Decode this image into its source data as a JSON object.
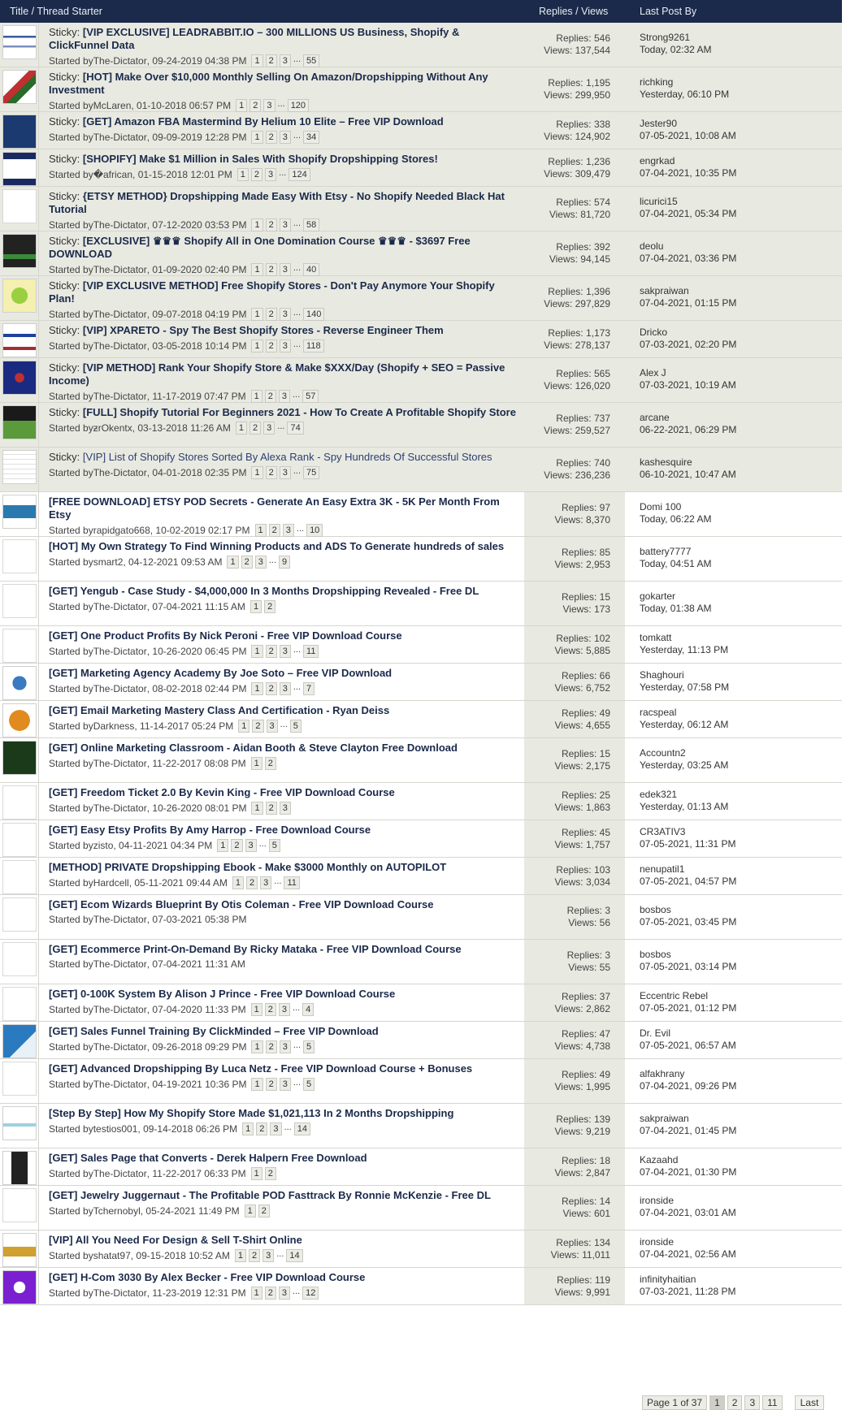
{
  "header": {
    "col1": "Title / Thread Starter",
    "col2": "Replies / Views",
    "col3": "Last Post By"
  },
  "sticky_label": "Sticky:",
  "started_by": "Started by",
  "threads": [
    {
      "sticky": true,
      "thumb": "shop",
      "title": "[VIP EXCLUSIVE] LEADRABBIT.IO – 300 MILLIONS US Business, Shopify & ClickFunnel Data",
      "starter": "The-Dictator",
      "date": "09-24-2019 04:38 PM",
      "pages": [
        "1",
        "2",
        "3",
        "55"
      ],
      "replies": "Replies: 546",
      "views": "Views: 137,544",
      "last_user": "Strong9261",
      "last_time": "Today, 02:32 AM"
    },
    {
      "sticky": true,
      "thumb": "money",
      "title": "[HOT] Make Over $10,000 Monthly Selling On Amazon/Dropshipping Without Any Investment",
      "starter": "McLaren",
      "date": "01-10-2018 06:57 PM",
      "pages": [
        "1",
        "2",
        "3",
        "120"
      ],
      "replies": "Replies: 1,195",
      "views": "Views: 299,950",
      "last_user": "richking",
      "last_time": "Yesterday, 06:10 PM"
    },
    {
      "sticky": true,
      "thumb": "helium",
      "title": "[GET] Amazon FBA Mastermind By Helium 10 Elite – Free VIP Download",
      "starter": "The-Dictator",
      "date": "09-09-2019 12:28 PM",
      "pages": [
        "1",
        "2",
        "3",
        "34"
      ],
      "replies": "Replies: 338",
      "views": "Views: 124,902",
      "last_user": "Jester90",
      "last_time": "07-05-2021, 10:08 AM"
    },
    {
      "sticky": true,
      "thumb": "screen",
      "title": "[SHOPIFY] Make $1 Million in Sales With Shopify Dropshipping Stores!",
      "starter": "�african",
      "date": "01-15-2018 12:01 PM",
      "pages": [
        "1",
        "2",
        "3",
        "124"
      ],
      "replies": "Replies: 1,236",
      "views": "Views: 309,479",
      "last_user": "engrkad",
      "last_time": "07-04-2021, 10:35 PM"
    },
    {
      "sticky": true,
      "thumb": "blank",
      "title": "{ETSY METHOD} Dropshipping Made Easy With Etsy - No Shopify Needed Black Hat Tutorial",
      "starter": "The-Dictator",
      "date": "07-12-2020 03:53 PM",
      "pages": [
        "1",
        "2",
        "3",
        "58"
      ],
      "replies": "Replies: 574",
      "views": "Views: 81,720",
      "last_user": "licurici15",
      "last_time": "07-04-2021, 05:34 PM"
    },
    {
      "sticky": true,
      "thumb": "dark",
      "title": "[EXCLUSIVE] ♛♛♛ Shopify All in One Domination Course ♛♛♛ - $3697 Free DOWNLOAD",
      "starter": "The-Dictator",
      "date": "01-09-2020 02:40 PM",
      "pages": [
        "1",
        "2",
        "3",
        "40"
      ],
      "replies": "Replies: 392",
      "views": "Views: 94,145",
      "last_user": "deolu",
      "last_time": "07-04-2021, 03:36 PM"
    },
    {
      "sticky": true,
      "thumb": "green",
      "title": "[VIP EXCLUSIVE METHOD] Free Shopify Stores - Don't Pay Anymore Your Shopify Plan!",
      "starter": "The-Dictator",
      "date": "09-07-2018 04:19 PM",
      "pages": [
        "1",
        "2",
        "3",
        "140"
      ],
      "replies": "Replies: 1,396",
      "views": "Views: 297,829",
      "last_user": "sakpraiwan",
      "last_time": "07-04-2021, 01:15 PM"
    },
    {
      "sticky": true,
      "thumb": "xpareto",
      "title": "[VIP] XPARETO - Spy The Best Shopify Stores - Reverse Engineer Them",
      "starter": "The-Dictator",
      "date": "03-05-2018 10:14 PM",
      "pages": [
        "1",
        "2",
        "3",
        "118"
      ],
      "replies": "Replies: 1,173",
      "views": "Views: 278,137",
      "last_user": "Dricko",
      "last_time": "07-03-2021, 02:20 PM"
    },
    {
      "sticky": true,
      "thumb": "seo",
      "title": "[VIP METHOD] Rank Your Shopify Store & Make $XXX/Day (Shopify + SEO = Passive Income)",
      "starter": "The-Dictator",
      "date": "11-17-2019 07:47 PM",
      "pages": [
        "1",
        "2",
        "3",
        "57"
      ],
      "replies": "Replies: 565",
      "views": "Views: 126,020",
      "last_user": "Alex J",
      "last_time": "07-03-2021, 10:19 AM"
    },
    {
      "sticky": true,
      "thumb": "shopify",
      "title": "[FULL] Shopify Tutorial For Beginners 2021 - How To Create A Profitable Shopify Store",
      "starter": "ƶrOkentx",
      "date": "03-13-2018 11:26 AM",
      "pages": [
        "1",
        "2",
        "3",
        "74"
      ],
      "replies": "Replies: 737",
      "views": "Views: 259,527",
      "last_user": "arcane",
      "last_time": "06-22-2021, 06:29 PM"
    },
    {
      "sticky": true,
      "plain": true,
      "thumb": "grid",
      "title": "[VIP] List of Shopify Stores Sorted By Alexa Rank - Spy Hundreds Of Successful Stores",
      "starter": "The-Dictator",
      "date": "04-01-2018 02:35 PM",
      "pages": [
        "1",
        "2",
        "3",
        "75"
      ],
      "replies": "Replies: 740",
      "views": "Views: 236,236",
      "last_user": "kashesquire",
      "last_time": "06-10-2021, 10:47 AM"
    },
    {
      "sticky": false,
      "thumb": "etsy",
      "title": "[FREE DOWNLOAD] ETSY POD Secrets - Generate An Easy Extra 3K - 5K Per Month From Etsy",
      "starter": "rapidgato668",
      "date": "10-02-2019 02:17 PM",
      "pages": [
        "1",
        "2",
        "3",
        "10"
      ],
      "replies": "Replies: 97",
      "views": "Views: 8,370",
      "last_user": "Domi 100",
      "last_time": "Today, 06:22 AM"
    },
    {
      "sticky": false,
      "thumb": "blank",
      "title": "[HOT] My Own Strategy To Find Winning Products and ADS To Generate hundreds of sales",
      "starter": "smart2",
      "date": "04-12-2021 09:53 AM",
      "pages": [
        "1",
        "2",
        "3",
        "9"
      ],
      "replies": "Replies: 85",
      "views": "Views: 2,953",
      "last_user": "battery7777",
      "last_time": "Today, 04:51 AM"
    },
    {
      "sticky": false,
      "thumb": "blank",
      "title": "[GET] Yengub - Case Study - $4,000,000 In 3 Months Dropshipping Revealed - Free DL",
      "starter": "The-Dictator",
      "date": "07-04-2021 11:15 AM",
      "pages": [
        "1",
        "2"
      ],
      "replies": "Replies: 15",
      "views": "Views: 173",
      "last_user": "gokarter",
      "last_time": "Today, 01:38 AM"
    },
    {
      "sticky": false,
      "thumb": "blank",
      "title": "[GET] One Product Profits By Nick Peroni - Free VIP Download Course",
      "starter": "The-Dictator",
      "date": "10-26-2020 06:45 PM",
      "pages": [
        "1",
        "2",
        "3",
        "11"
      ],
      "replies": "Replies: 102",
      "views": "Views: 5,885",
      "last_user": "tomkatt",
      "last_time": "Yesterday, 11:13 PM"
    },
    {
      "sticky": false,
      "thumb": "agency",
      "title": "[GET] Marketing Agency Academy By Joe Soto – Free VIP Download",
      "starter": "The-Dictator",
      "date": "08-02-2018 02:44 PM",
      "pages": [
        "1",
        "2",
        "3",
        "7"
      ],
      "replies": "Replies: 66",
      "views": "Views: 6,752",
      "last_user": "Shaghouri",
      "last_time": "Yesterday, 07:58 PM"
    },
    {
      "sticky": false,
      "thumb": "badge",
      "title": "[GET] Email Marketing Mastery Class And Certification - Ryan Deiss",
      "starter": "Darkness",
      "date": "11-14-2017 05:24 PM",
      "pages": [
        "1",
        "2",
        "3",
        "5"
      ],
      "replies": "Replies: 49",
      "views": "Views: 4,655",
      "last_user": "racspeal",
      "last_time": "Yesterday, 06:12 AM"
    },
    {
      "sticky": false,
      "thumb": "marketing",
      "title": "[GET] Online Marketing Classroom - Aidan Booth & Steve Clayton Free Download",
      "starter": "The-Dictator",
      "date": "11-22-2017 08:08 PM",
      "pages": [
        "1",
        "2"
      ],
      "replies": "Replies: 15",
      "views": "Views: 2,175",
      "last_user": "Accountn2",
      "last_time": "Yesterday, 03:25 AM"
    },
    {
      "sticky": false,
      "thumb": "blank",
      "title": "[GET] Freedom Ticket 2.0 By Kevin King - Free VIP Download Course",
      "starter": "The-Dictator",
      "date": "10-26-2020 08:01 PM",
      "pages": [
        "1",
        "2",
        "3"
      ],
      "replies": "Replies: 25",
      "views": "Views: 1,863",
      "last_user": "edek321",
      "last_time": "Yesterday, 01:13 AM"
    },
    {
      "sticky": false,
      "thumb": "blank",
      "title": "[GET] Easy Etsy Profits By Amy Harrop - Free Download Course",
      "starter": "zisto",
      "date": "04-11-2021 04:34 PM",
      "pages": [
        "1",
        "2",
        "3",
        "5"
      ],
      "replies": "Replies: 45",
      "views": "Views: 1,757",
      "last_user": "CR3ATIV3",
      "last_time": "07-05-2021, 11:31 PM"
    },
    {
      "sticky": false,
      "thumb": "blank",
      "title": "[METHOD] PRIVATE Dropshipping Ebook - Make $3000 Monthly on AUTOPILOT",
      "starter": "Hardcell",
      "date": "05-11-2021 09:44 AM",
      "pages": [
        "1",
        "2",
        "3",
        "11"
      ],
      "replies": "Replies: 103",
      "views": "Views: 3,034",
      "last_user": "nenupatil1",
      "last_time": "07-05-2021, 04:57 PM"
    },
    {
      "sticky": false,
      "thumb": "blank",
      "title": "[GET] Ecom Wizards Blueprint By Otis Coleman - Free VIP Download Course",
      "starter": "The-Dictator",
      "date": "07-03-2021 05:38 PM",
      "pages": [],
      "replies": "Replies: 3",
      "views": "Views: 56",
      "last_user": "bosbos",
      "last_time": "07-05-2021, 03:45 PM"
    },
    {
      "sticky": false,
      "thumb": "blank",
      "title": "[GET] Ecommerce Print-On-Demand By Ricky Mataka - Free VIP Download Course",
      "starter": "The-Dictator",
      "date": "07-04-2021 11:31 AM",
      "pages": [],
      "replies": "Replies: 3",
      "views": "Views: 55",
      "last_user": "bosbos",
      "last_time": "07-05-2021, 03:14 PM"
    },
    {
      "sticky": false,
      "thumb": "blank",
      "title": "[GET] 0-100K System By Alison J Prince - Free VIP Download Course",
      "starter": "The-Dictator",
      "date": "07-04-2020 11:33 PM",
      "pages": [
        "1",
        "2",
        "3",
        "4"
      ],
      "replies": "Replies: 37",
      "views": "Views: 2,862",
      "last_user": "Eccentric Rebel",
      "last_time": "07-05-2021, 01:12 PM"
    },
    {
      "sticky": false,
      "thumb": "funnel",
      "title": "[GET] Sales Funnel Training By ClickMinded – Free VIP Download",
      "starter": "The-Dictator",
      "date": "09-26-2018 09:29 PM",
      "pages": [
        "1",
        "2",
        "3",
        "5"
      ],
      "replies": "Replies: 47",
      "views": "Views: 4,738",
      "last_user": "Dr. Evil",
      "last_time": "07-05-2021, 06:57 AM"
    },
    {
      "sticky": false,
      "thumb": "blank",
      "title": "[GET] Advanced Dropshipping By Luca Netz - Free VIP Download Course + Bonuses",
      "starter": "The-Dictator",
      "date": "04-19-2021 10:36 PM",
      "pages": [
        "1",
        "2",
        "3",
        "5"
      ],
      "replies": "Replies: 49",
      "views": "Views: 1,995",
      "last_user": "alfakhrany",
      "last_time": "07-04-2021, 09:26 PM"
    },
    {
      "sticky": false,
      "thumb": "chart",
      "title": "[Step By Step] How My Shopify Store Made $1,021,113 In 2 Months Dropshipping",
      "starter": "testios001",
      "date": "09-14-2018 06:26 PM",
      "pages": [
        "1",
        "2",
        "3",
        "14"
      ],
      "replies": "Replies: 139",
      "views": "Views: 9,219",
      "last_user": "sakpraiwan",
      "last_time": "07-04-2021, 01:45 PM"
    },
    {
      "sticky": false,
      "thumb": "phone",
      "title": "[GET] Sales Page that Converts - Derek Halpern Free Download",
      "starter": "The-Dictator",
      "date": "11-22-2017 06:33 PM",
      "pages": [
        "1",
        "2"
      ],
      "replies": "Replies: 18",
      "views": "Views: 2,847",
      "last_user": "Kazaahd",
      "last_time": "07-04-2021, 01:30 PM"
    },
    {
      "sticky": false,
      "thumb": "blank",
      "title": "[GET] Jewelry Juggernaut - The Profitable POD Fasttrack By Ronnie McKenzie - Free DL",
      "starter": "Tchernobyl",
      "date": "05-24-2021 11:49 PM",
      "pages": [
        "1",
        "2"
      ],
      "replies": "Replies: 14",
      "views": "Views: 601",
      "last_user": "ironside",
      "last_time": "07-04-2021, 03:01 AM"
    },
    {
      "sticky": false,
      "thumb": "shirt",
      "title": "[VIP] All You Need For Design & Sell T-Shirt Online",
      "starter": "shatat97",
      "date": "09-15-2018 10:52 AM",
      "pages": [
        "1",
        "2",
        "3",
        "14"
      ],
      "replies": "Replies: 134",
      "views": "Views: 11,011",
      "last_user": "ironside",
      "last_time": "07-04-2021, 02:56 AM"
    },
    {
      "sticky": false,
      "thumb": "hcom",
      "title": "[GET] H-Com 3030 By Alex Becker - Free VIP Download Course",
      "starter": "The-Dictator",
      "date": "11-23-2019 12:31 PM",
      "pages": [
        "1",
        "2",
        "3",
        "12"
      ],
      "replies": "Replies: 119",
      "views": "Views: 9,991",
      "last_user": "infinityhaitian",
      "last_time": "07-03-2021, 11:28 PM"
    }
  ],
  "pager": {
    "label": "Page 1 of 37",
    "pages": [
      "1",
      "2",
      "3",
      "11"
    ],
    "last": "Last"
  }
}
